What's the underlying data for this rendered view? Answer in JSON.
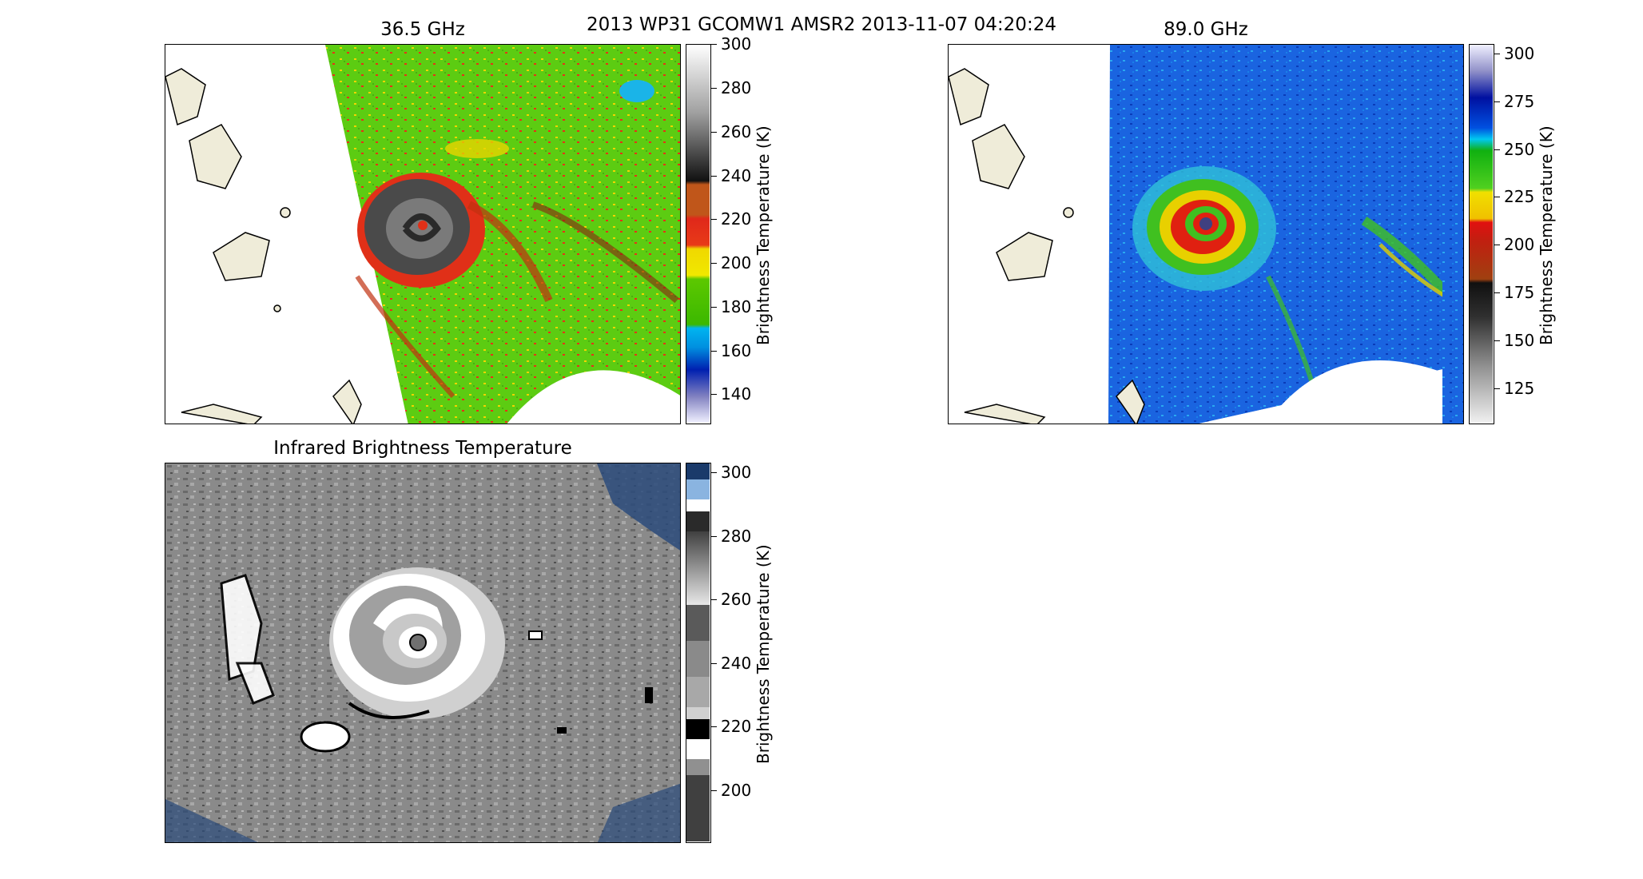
{
  "figure": {
    "suptitle": "2013 WP31 GCOMW1 AMSR2 2013-11-07 04:20:24"
  },
  "panels": [
    {
      "title": "36.5 GHz",
      "colorbar_label": "Brightness Temperature (K)",
      "ticks": [
        "300",
        "280",
        "260",
        "240",
        "220",
        "200",
        "180",
        "160",
        "140"
      ],
      "colormap": [
        "#ffffff",
        "#d8d8d8",
        "#a0a0a0",
        "#606060",
        "#1a1a1a",
        "#c0561a",
        "#e0281a",
        "#f0d800",
        "#5cc800",
        "#3cb800",
        "#00a8e8",
        "#0030c0",
        "#e8e8f8"
      ]
    },
    {
      "title": "89.0 GHz",
      "colorbar_label": "Brightness Temperature (K)",
      "ticks": [
        "300",
        "275",
        "250",
        "225",
        "200",
        "175",
        "150",
        "125"
      ],
      "colormap": [
        "#f0f0ff",
        "#9090c8",
        "#0010a0",
        "#0050e0",
        "#00c8f0",
        "#10b010",
        "#50d020",
        "#f0e000",
        "#e01010",
        "#a04010",
        "#101010",
        "#707070",
        "#e8e8e8"
      ]
    },
    {
      "title": "Infrared Brightness Temperature",
      "colorbar_label": "Brightness Temperature (K)",
      "ticks": [
        "300",
        "280",
        "260",
        "240",
        "220",
        "200"
      ],
      "colormap": [
        "#1a3a6a",
        "#8ab4e0",
        "#ffffff",
        "#2a2a2a",
        "#d0d0d0",
        "#5a5a5a",
        "#a8a8a8",
        "#000000",
        "#ffffff",
        "#808080",
        "#404040"
      ]
    }
  ]
}
